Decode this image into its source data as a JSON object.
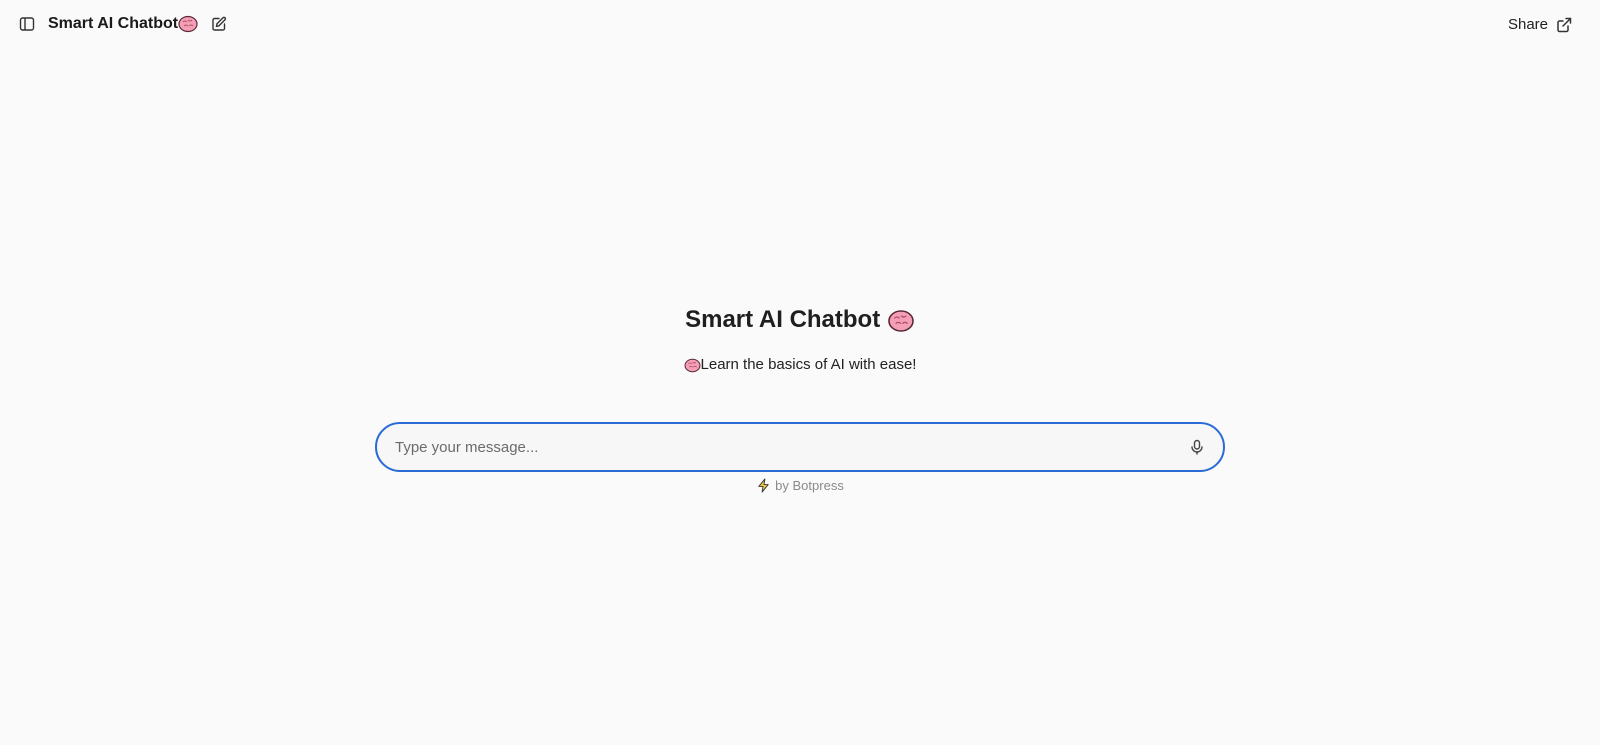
{
  "header": {
    "title": "Smart AI Chatbot",
    "share_label": "Share",
    "icons": {
      "sidebar_toggle": "sidebar-toggle-icon",
      "title_emoji": "brain-icon",
      "new_chat": "edit-icon",
      "share": "external-link-icon"
    }
  },
  "hero": {
    "title": "Smart AI Chatbot",
    "subtitle": "Learn the basics of AI with ease!"
  },
  "composer": {
    "placeholder": "Type your message...",
    "value": "",
    "mic_icon": "microphone-icon"
  },
  "footer": {
    "powered_by": "by Botpress",
    "icon": "lightning-icon"
  },
  "colors": {
    "background": "#fafafa",
    "accent_border": "#2b6bd6",
    "brain_pink": "#f28ca6"
  }
}
